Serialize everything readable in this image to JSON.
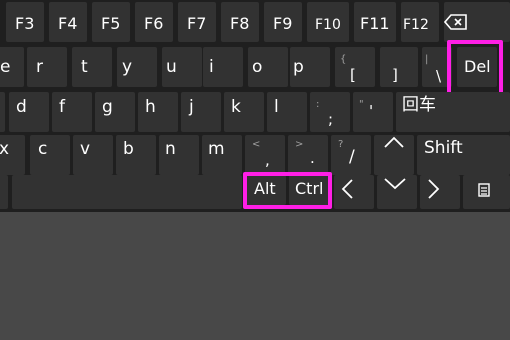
{
  "colors": {
    "key_bg": "#323232",
    "panel_bg": "#1f1f1f",
    "lower_bg": "#484848",
    "highlight": "#ff1fe6"
  },
  "row1": [
    "F3",
    "F4",
    "F5",
    "F6",
    "F7",
    "F8",
    "F9",
    "F10",
    "F11",
    "F12"
  ],
  "row1_icon": "backspace-icon",
  "row2": [
    "e",
    "r",
    "t",
    "y",
    "u",
    "i",
    "o",
    "p"
  ],
  "row2_sym": {
    "bracket_left_top": "{",
    "bracket_left_bottom": "[",
    "bracket_right_bottom": "]",
    "pipe_top": "|",
    "backslash_bottom": "\\"
  },
  "row2_del": "Del",
  "row3": [
    "d",
    "f",
    "g",
    "h",
    "j",
    "k",
    "l"
  ],
  "row3_sym": {
    "colon_top": ":",
    "semicolon_bottom": ";",
    "quote_top": "\"",
    "quote_bottom": "'"
  },
  "row3_enter": "回车",
  "row4": [
    "x",
    "c",
    "v",
    "b",
    "n",
    "m"
  ],
  "row4_sym": {
    "lt_top": "<",
    "comma_bottom": ",",
    "gt_top": ">",
    "period_bottom": ".",
    "question_top": "?",
    "slash_bottom": "/"
  },
  "row4_shift": "Shift",
  "row5": {
    "alt": "Alt",
    "ctrl": "Ctrl"
  },
  "icons": [
    "up-arrow-icon",
    "left-arrow-icon",
    "down-arrow-icon",
    "right-arrow-icon",
    "keyboard-menu-icon"
  ]
}
